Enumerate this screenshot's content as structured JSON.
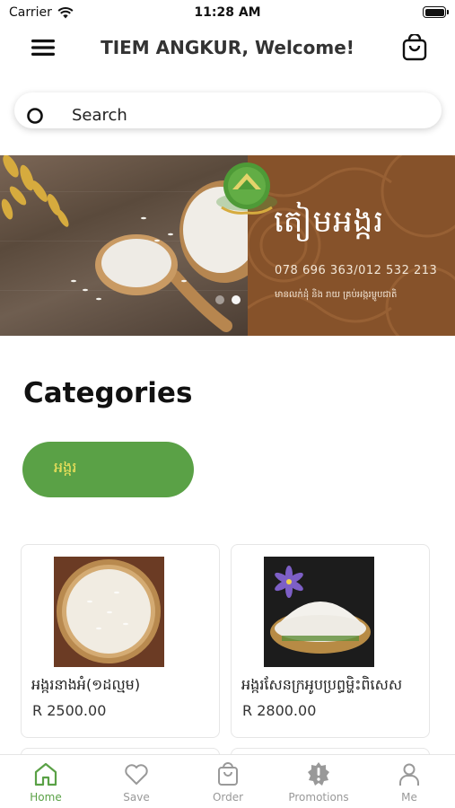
{
  "status_bar": {
    "carrier": "Carrier",
    "time": "11:28 AM"
  },
  "header": {
    "title": "TIEM ANGKUR, Welcome!"
  },
  "search": {
    "placeholder": "Search"
  },
  "banner": {
    "brand": "តៀមអង្ករ",
    "phone": "078 696 363/012 532 213",
    "tagline": "មានលក់ដុំ និង រាយ គ្រប់អង្ករម្ហូបជាតិ",
    "dots": 2,
    "active_dot": 1
  },
  "categories": {
    "title": "Categories",
    "items": [
      {
        "label": "អង្ករ"
      }
    ]
  },
  "products": [
    {
      "name": "អង្ករនាងអំ(១ដល្មម)",
      "price": "R 2500.00"
    },
    {
      "name": "អង្ករសែនក្រអូបប្រព្ធម្ហិះពិសេស",
      "price": "R 2800.00"
    }
  ],
  "tab_bar": {
    "items": [
      {
        "label": "Home",
        "icon": "home-icon",
        "active": true
      },
      {
        "label": "Save",
        "icon": "heart-icon",
        "active": false
      },
      {
        "label": "Order",
        "icon": "bag-icon",
        "active": false
      },
      {
        "label": "Promotions",
        "icon": "badge-alert-icon",
        "active": false
      },
      {
        "label": "Me",
        "icon": "person-icon",
        "active": false
      }
    ]
  },
  "colors": {
    "accent": "#5aa146",
    "banner_brown": "#86522a",
    "chip_text": "#f2e35c"
  }
}
